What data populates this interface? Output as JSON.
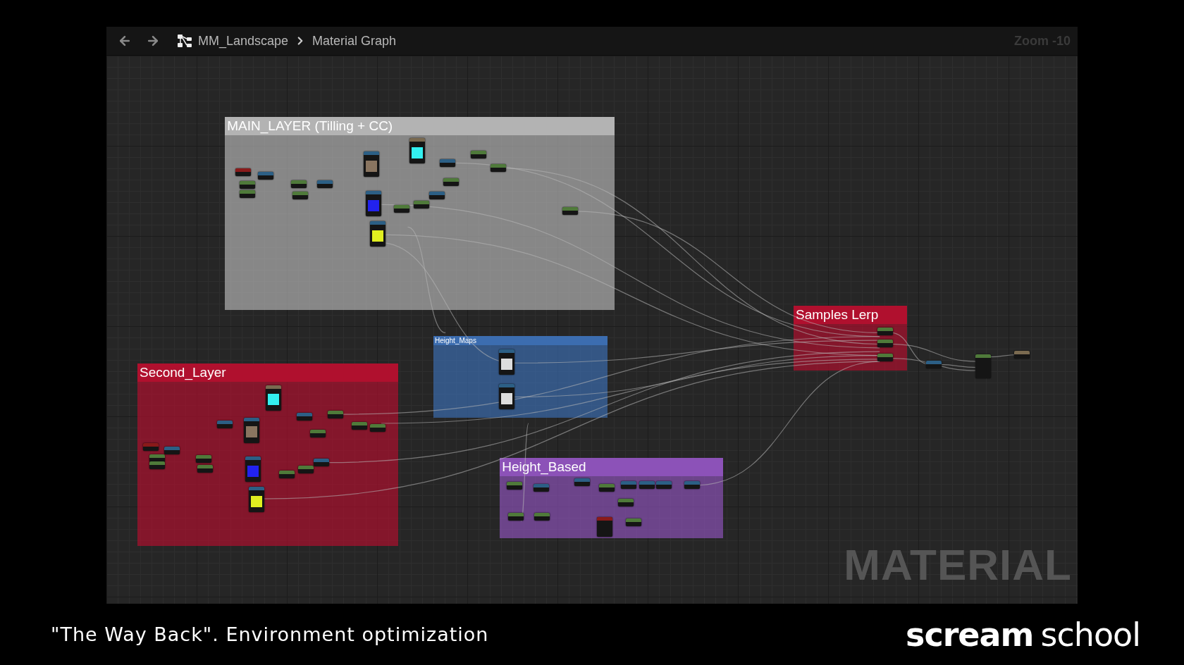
{
  "toolbar": {
    "breadcrumb": [
      "MM_Landscape",
      "Material Graph"
    ],
    "zoom": "Zoom -10"
  },
  "comments": [
    {
      "title": "MAIN_LAYER (Tilling + CC)",
      "color": "#b3b3b3"
    },
    {
      "title": "Second_Layer",
      "color": "#b0102e"
    },
    {
      "title": "Height_Maps",
      "color": "#3c6db0"
    },
    {
      "title": "Height_Based",
      "color": "#8c52b8"
    },
    {
      "title": "Samples Lerp",
      "color": "#b0102e"
    }
  ],
  "graph_label": "MATERIAL",
  "caption": "\"The Way Back\". Environment optimization",
  "logo": {
    "word_1": "scream",
    "word_2": "school"
  }
}
